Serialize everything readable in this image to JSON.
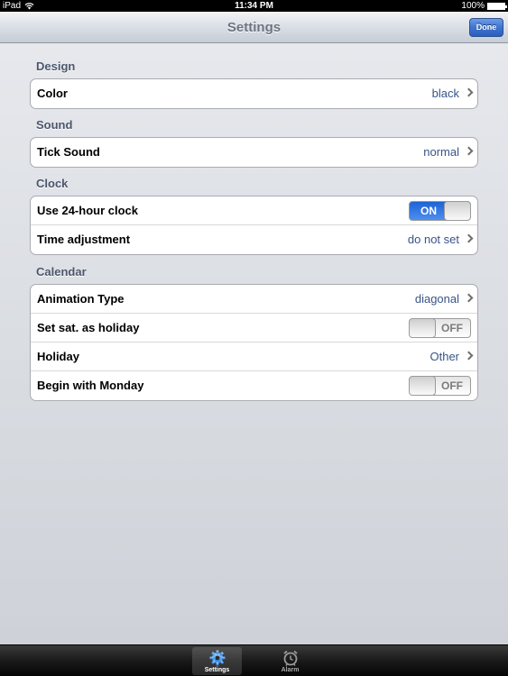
{
  "status_bar": {
    "device": "iPad",
    "time": "11:34 PM",
    "battery": "100%"
  },
  "nav": {
    "title": "Settings",
    "done_label": "Done"
  },
  "sections": {
    "design": {
      "header": "Design",
      "color_label": "Color",
      "color_value": "black"
    },
    "sound": {
      "header": "Sound",
      "tick_label": "Tick Sound",
      "tick_value": "normal"
    },
    "clock": {
      "header": "Clock",
      "hour24_label": "Use 24-hour clock",
      "hour24_state": "ON",
      "time_adj_label": "Time adjustment",
      "time_adj_value": "do not set"
    },
    "calendar": {
      "header": "Calendar",
      "animation_label": "Animation Type",
      "animation_value": "diagonal",
      "saturday_label": "Set sat. as holiday",
      "saturday_state": "OFF",
      "holiday_label": "Holiday",
      "holiday_value": "Other",
      "monday_label": "Begin with Monday",
      "monday_state": "OFF"
    }
  },
  "tab_bar": {
    "settings_label": "Settings",
    "alarm_label": "Alarm",
    "settings_icon": "gear-icon",
    "alarm_icon": "alarm-clock-icon"
  },
  "colors": {
    "accent_blue": "#2b5fbf",
    "value_text": "#385487",
    "section_header": "#4c566c"
  }
}
